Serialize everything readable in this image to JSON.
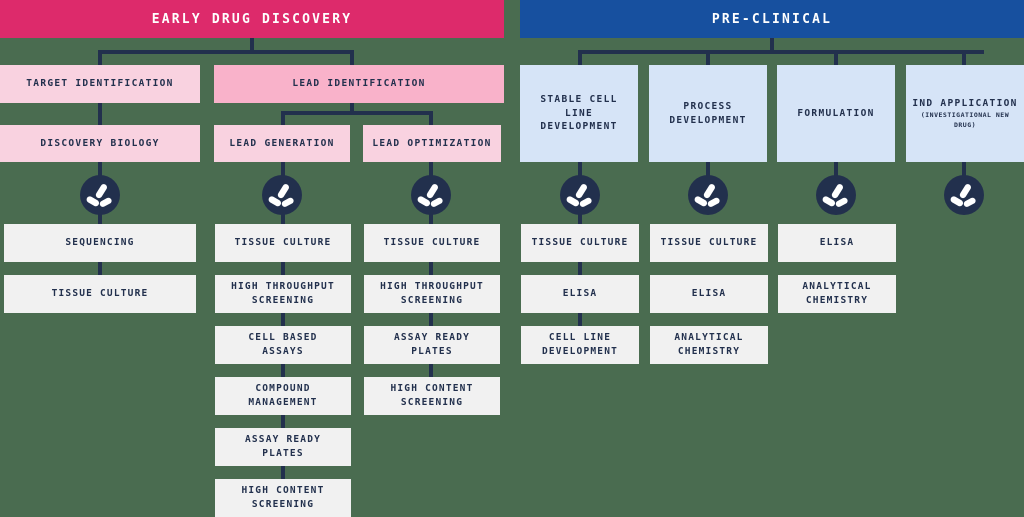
{
  "diagram": {
    "title_hidden": "Drug discovery and pre-clinical workflow",
    "colors": {
      "early_header_bg": "#dd2a6b",
      "preclinical_header_bg": "#17509f",
      "pink_light": "#f9d2e0",
      "pink_mid": "#f9b2ca",
      "blue_light": "#d6e4f7",
      "grey_box": "#f1f1f1",
      "connector": "#22304d",
      "text": "#22304d",
      "background": "#4a6c50"
    },
    "icon_name": "propeller-logo-icon"
  },
  "phases": [
    {
      "id": "early",
      "label": "EARLY DRUG DISCOVERY"
    },
    {
      "id": "preclinical",
      "label": "PRE-CLINICAL"
    }
  ],
  "stages": {
    "target_identification": "TARGET IDENTIFICATION",
    "lead_identification": "LEAD IDENTIFICATION",
    "discovery_biology": "DISCOVERY BIOLOGY",
    "lead_generation": "LEAD GENERATION",
    "lead_optimization": "LEAD OPTIMIZATION",
    "stable_cell_line": "STABLE CELL\nLINE DEVELOPMENT",
    "stable_cell_line_l1": "STABLE CELL",
    "stable_cell_line_l2": "LINE DEVELOPMENT",
    "process_development_l1": "PROCESS",
    "process_development_l2": "DEVELOPMENT",
    "formulation": "FORMULATION",
    "ind_application": "IND APPLICATION",
    "ind_application_sub": "(INVESTIGATIONAL NEW DRUG)"
  },
  "columns": [
    {
      "id": "discovery-biology",
      "items": [
        {
          "label": "SEQUENCING"
        },
        {
          "label": "TISSUE CULTURE"
        }
      ]
    },
    {
      "id": "lead-generation",
      "items": [
        {
          "label": "TISSUE CULTURE"
        },
        {
          "line1": "HIGH THROUGHPUT",
          "line2": "SCREENING"
        },
        {
          "line1": "CELL BASED",
          "line2": "ASSAYS"
        },
        {
          "line1": "COMPOUND",
          "line2": "MANAGEMENT"
        },
        {
          "line1": "ASSAY READY",
          "line2": "PLATES"
        },
        {
          "line1": "HIGH CONTENT",
          "line2": "SCREENING"
        }
      ]
    },
    {
      "id": "lead-optimization",
      "items": [
        {
          "label": "TISSUE CULTURE"
        },
        {
          "line1": "HIGH THROUGHPUT",
          "line2": "SCREENING"
        },
        {
          "line1": "ASSAY READY",
          "line2": "PLATES"
        },
        {
          "line1": "HIGH CONTENT",
          "line2": "SCREENING"
        }
      ]
    },
    {
      "id": "stable-cell-line",
      "items": [
        {
          "label": "TISSUE CULTURE"
        },
        {
          "label": "ELISA"
        },
        {
          "line1": "CELL LINE",
          "line2": "DEVELOPMENT"
        }
      ]
    },
    {
      "id": "process-development",
      "items": [
        {
          "label": "TISSUE CULTURE"
        },
        {
          "label": "ELISA"
        },
        {
          "line1": "ANALYTICAL",
          "line2": "CHEMISTRY"
        }
      ]
    },
    {
      "id": "formulation",
      "items": [
        {
          "label": "ELISA"
        },
        {
          "line1": "ANALYTICAL",
          "line2": "CHEMISTRY"
        }
      ]
    },
    {
      "id": "ind-application",
      "items": []
    }
  ]
}
